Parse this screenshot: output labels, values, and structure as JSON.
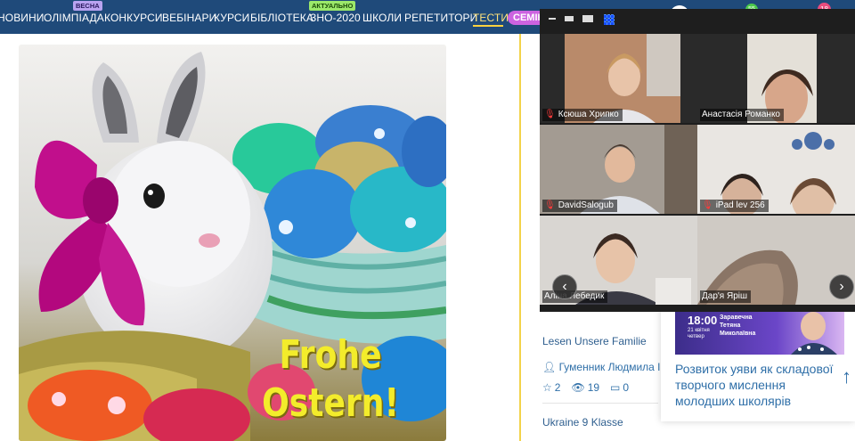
{
  "nav": {
    "items": [
      "НОВИНИ",
      "ОЛІМПІАДА",
      "КОНКУРСИ",
      "ВЕБІНАРИ",
      "КУРСИ",
      "БІБЛІОТЕКА",
      "ЗНО-2020",
      "ШКОЛИ",
      "РЕПЕТИТОРИ",
      "ТЕСТИ"
    ],
    "badge_spring": "ВЕСНА",
    "badge_actual": "АКТУАЛЬНО",
    "seminar": "СЕМІНАРИ",
    "notification_count": "18",
    "green_badge": "55",
    "active_color": "#ffe27a"
  },
  "image": {
    "text_line1": "Frohe",
    "text_line2": "Ostern!"
  },
  "cards": {
    "title1": "Lesen Unsere Familie",
    "author": "Гуменник Людмила Ів",
    "likes": "2",
    "views": "19",
    "comments": "0",
    "title2": "Ukraine 9 Klasse"
  },
  "webinar": {
    "time": "18:00",
    "date": "21 квітня четвер",
    "presenter": "Заравечна Тетяна Миколаївна",
    "title": "Розвиток уяви як складової творчого мислення молодших школярів"
  },
  "zoom": {
    "participants": [
      {
        "name": "Ксюша Хрипко",
        "muted": true
      },
      {
        "name": "Анастасія Романко",
        "muted": false
      },
      {
        "name": "DavidSalogub",
        "muted": true
      },
      {
        "name": "iPad lev 256",
        "muted": true
      },
      {
        "name": "Аліна Лебедик",
        "muted": false
      },
      {
        "name": "Дар'я Яріш",
        "muted": false
      }
    ]
  }
}
